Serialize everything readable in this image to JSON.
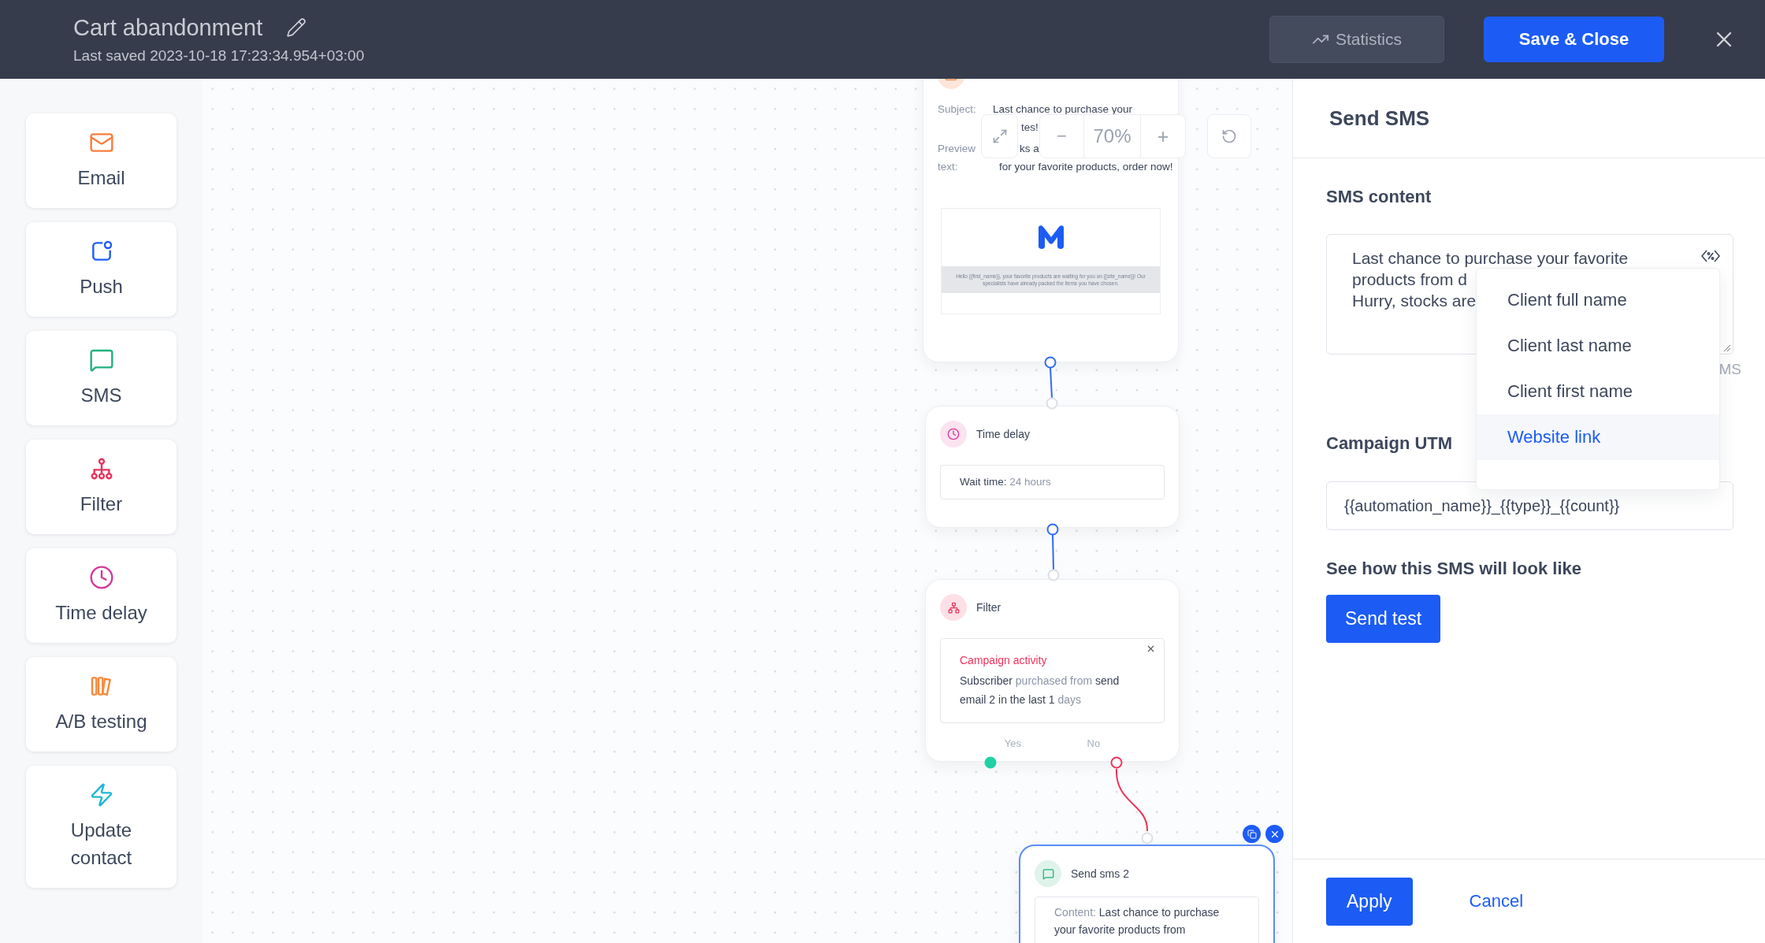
{
  "header": {
    "title": "Cart abandonment",
    "last_saved": "Last saved 2023-10-18 17:23:34.954+03:00",
    "statistics_button": "Statistics",
    "save_button": "Save & Close"
  },
  "palette": [
    {
      "label": "Email",
      "kind": "email",
      "color": "#f97d3c"
    },
    {
      "label": "Push",
      "kind": "push",
      "color": "#1c5cf5"
    },
    {
      "label": "SMS",
      "kind": "sms",
      "color": "#22b07d"
    },
    {
      "label": "Filter",
      "kind": "filter",
      "color": "#e8315b"
    },
    {
      "label": "Time delay",
      "kind": "delay",
      "color": "#d6389a"
    },
    {
      "label": "A/B testing",
      "kind": "ab",
      "color": "#f6893b"
    },
    {
      "label": "Update contact",
      "kind": "update",
      "color": "#1fb6d6"
    }
  ],
  "zoom": {
    "value": "70%",
    "minus": "−",
    "plus": "+"
  },
  "email_node": {
    "subject_label": "Subject:",
    "subject_lines": [
      "Last chance to purchase your",
      "tes!"
    ],
    "preview_label_lines": [
      "Preview",
      "text:"
    ],
    "preview_lines": [
      "ks a",
      "for your favorite products, order now!"
    ],
    "thumbnail_text": "Hello {{first_name}}, your favorite products are waiting for you on {{site_name}}! Our specialists have already packed the items you have chosen."
  },
  "delay_node": {
    "title": "Time delay",
    "label": "Wait time:",
    "value": "24 hours"
  },
  "filter_node": {
    "title": "Filter",
    "condition_title": "Campaign activity",
    "condition": [
      {
        "text": "Subscriber",
        "muted": false
      },
      {
        "text": "purchased from",
        "muted": true
      },
      {
        "text": "send email 2 in the last 1",
        "muted": false
      },
      {
        "text": "days",
        "muted": true
      }
    ],
    "yes": "Yes",
    "no": "No"
  },
  "sms_node": {
    "title": "Send sms 2",
    "selected": true,
    "content_label": "Content:",
    "content": "Last chance to purchase your favorite products from"
  },
  "panel": {
    "title": "Send SMS",
    "content_heading": "SMS content",
    "content_lines": [
      "Last chance to purchase your favorite",
      "products from d",
      "Hurry, stocks are"
    ],
    "counter": "MS",
    "utm_heading": "Campaign UTM",
    "utm_value": "{{automation_name}}_{{type}}_{{count}}",
    "preview_heading": "See how this SMS will look like",
    "send_test": "Send test",
    "apply": "Apply",
    "cancel": "Cancel"
  },
  "variables_menu": [
    {
      "label": "Client full name",
      "selected": false
    },
    {
      "label": "Client last name",
      "selected": false
    },
    {
      "label": "Client first name",
      "selected": false
    },
    {
      "label": "Website link",
      "selected": true
    }
  ]
}
